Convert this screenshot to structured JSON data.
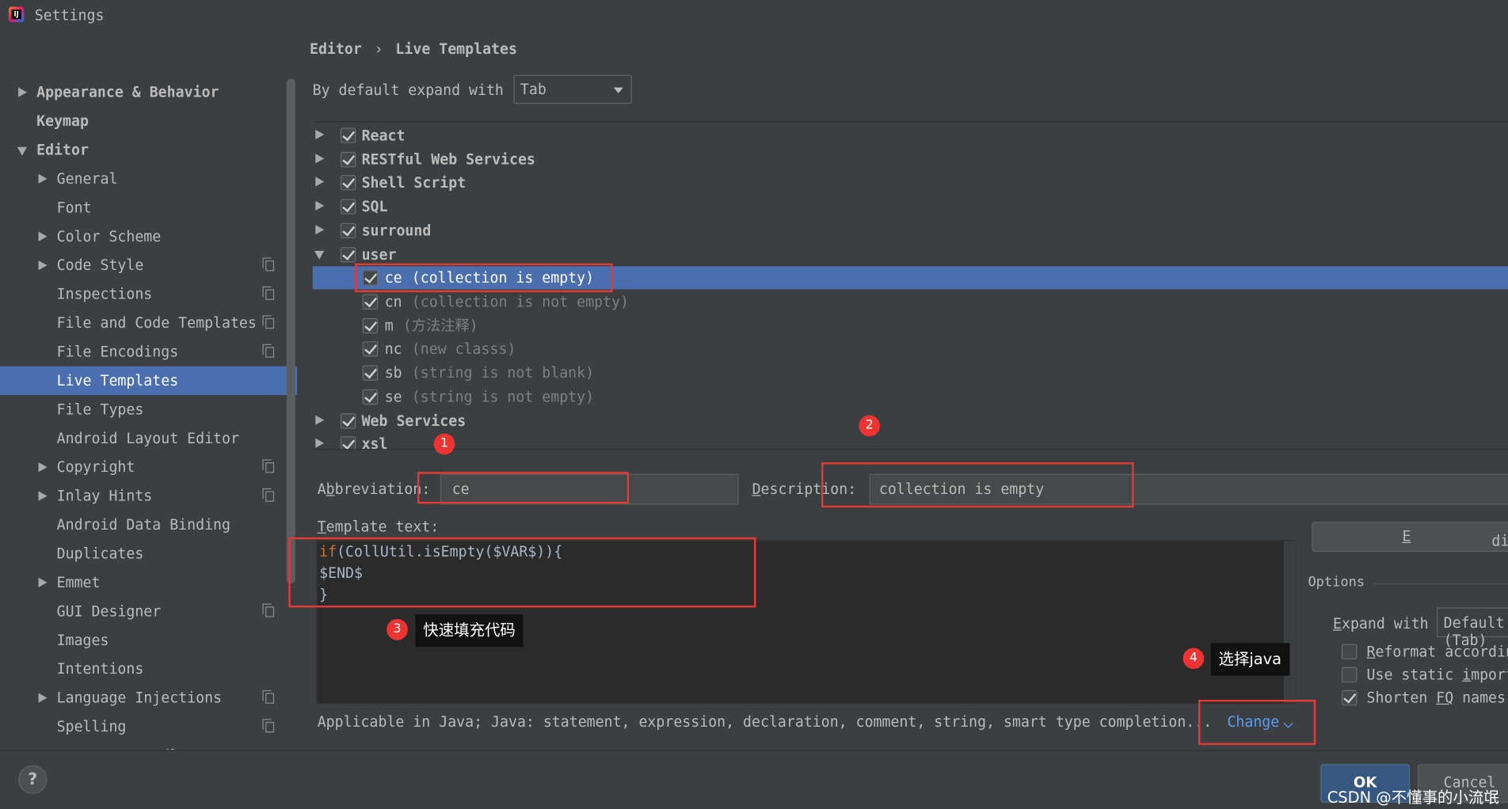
{
  "window": {
    "title": "Settings"
  },
  "search": {
    "placeholder": ""
  },
  "sidebar": {
    "items": [
      {
        "label": "Appearance & Behavior",
        "bold": true,
        "arrow": "right",
        "indent": 0
      },
      {
        "label": "Keymap",
        "bold": true,
        "arrow": "none",
        "indent": 0
      },
      {
        "label": "Editor",
        "bold": true,
        "arrow": "down",
        "indent": 0
      },
      {
        "label": "General",
        "bold": false,
        "arrow": "right",
        "indent": 1
      },
      {
        "label": "Font",
        "bold": false,
        "arrow": "none",
        "indent": 1
      },
      {
        "label": "Color Scheme",
        "bold": false,
        "arrow": "right",
        "indent": 1
      },
      {
        "label": "Code Style",
        "bold": false,
        "arrow": "right",
        "indent": 1,
        "copy": true
      },
      {
        "label": "Inspections",
        "bold": false,
        "arrow": "none",
        "indent": 1,
        "copy": true
      },
      {
        "label": "File and Code Templates",
        "bold": false,
        "arrow": "none",
        "indent": 1,
        "copy": true
      },
      {
        "label": "File Encodings",
        "bold": false,
        "arrow": "none",
        "indent": 1,
        "copy": true
      },
      {
        "label": "Live Templates",
        "bold": false,
        "arrow": "none",
        "indent": 1,
        "selected": true
      },
      {
        "label": "File Types",
        "bold": false,
        "arrow": "none",
        "indent": 1
      },
      {
        "label": "Android Layout Editor",
        "bold": false,
        "arrow": "none",
        "indent": 1
      },
      {
        "label": "Copyright",
        "bold": false,
        "arrow": "right",
        "indent": 1,
        "copy": true
      },
      {
        "label": "Inlay Hints",
        "bold": false,
        "arrow": "right",
        "indent": 1,
        "copy": true
      },
      {
        "label": "Android Data Binding",
        "bold": false,
        "arrow": "none",
        "indent": 1
      },
      {
        "label": "Duplicates",
        "bold": false,
        "arrow": "none",
        "indent": 1
      },
      {
        "label": "Emmet",
        "bold": false,
        "arrow": "right",
        "indent": 1
      },
      {
        "label": "GUI Designer",
        "bold": false,
        "arrow": "none",
        "indent": 1,
        "copy": true
      },
      {
        "label": "Images",
        "bold": false,
        "arrow": "none",
        "indent": 1
      },
      {
        "label": "Intentions",
        "bold": false,
        "arrow": "none",
        "indent": 1
      },
      {
        "label": "Language Injections",
        "bold": false,
        "arrow": "right",
        "indent": 1,
        "copy": true
      },
      {
        "label": "Spelling",
        "bold": false,
        "arrow": "none",
        "indent": 1,
        "copy": true
      },
      {
        "label": "TextMate Bundles",
        "bold": false,
        "arrow": "none",
        "indent": 1
      }
    ]
  },
  "breadcrumb": {
    "parent": "Editor",
    "separator": "›",
    "current": "Live Templates"
  },
  "expand": {
    "label": "By default expand with",
    "value": "Tab"
  },
  "template_tree": {
    "groups_before": [
      {
        "name": "React",
        "checked": true
      },
      {
        "name": "RESTful Web Services",
        "checked": true
      },
      {
        "name": "Shell Script",
        "checked": true
      },
      {
        "name": "SQL",
        "checked": true
      },
      {
        "name": "surround",
        "checked": true
      }
    ],
    "open_group": {
      "name": "user",
      "checked": true
    },
    "templates": [
      {
        "abbr": "ce",
        "desc": "(collection is empty)",
        "checked": true,
        "selected": true
      },
      {
        "abbr": "cn",
        "desc": "(collection is not empty)",
        "checked": true
      },
      {
        "abbr": "m",
        "desc": "(方法注释)",
        "checked": true
      },
      {
        "abbr": "nc",
        "desc": "(new classs)",
        "checked": true
      },
      {
        "abbr": "sb",
        "desc": "(string is not blank)",
        "checked": true
      },
      {
        "abbr": "se",
        "desc": "(string is not empty)",
        "checked": true
      }
    ],
    "groups_after": [
      {
        "name": "Web Services",
        "checked": true
      },
      {
        "name": "xsl",
        "checked": true
      }
    ]
  },
  "abbreviation": {
    "label_pre": "A",
    "label_u": "b",
    "label_post": "breviation:",
    "value": "ce"
  },
  "description": {
    "label_u": "D",
    "label_post": "escription:",
    "value": "collection is empty"
  },
  "template_text": {
    "label_u": "T",
    "label_post": "emplate text:",
    "line1_kw": "if",
    "line1_rest": "(CollUtil.isEmpty($VAR$)){",
    "line2": "$END$",
    "line3": "}"
  },
  "applicable": {
    "text": "Applicable in Java; Java: statement, expression, declaration, comment, string, smart type completion...",
    "link": "Change"
  },
  "options": {
    "edit_variables_pre": "",
    "edit_variables_u": "E",
    "edit_variables_post": "dit variables",
    "title": "Options",
    "expand_with_u": "E",
    "expand_with_post": "xpand with",
    "expand_with_value": "Default (Tab)",
    "reformat_u": "R",
    "reformat_post": "eformat according to style",
    "static_pre": "Use static ",
    "static_u": "i",
    "static_post": "mport if possible",
    "shorten_pre": "Shorten ",
    "shorten_u": "FQ",
    "shorten_post": " names",
    "reformat_checked": false,
    "static_checked": false,
    "shorten_checked": true
  },
  "buttons": {
    "help": "?",
    "ok": "OK",
    "cancel": "Cancel"
  },
  "annotations": {
    "badge1": "1",
    "badge2": "2",
    "badge3": "3",
    "badge4": "4",
    "callout3": "快速填充代码",
    "callout4": "选择java",
    "watermark": "CSDN @不懂事的小流氓"
  },
  "colors": {
    "selection": "#4b6eaf",
    "annotation_red": "#e53935",
    "link": "#589df6"
  }
}
